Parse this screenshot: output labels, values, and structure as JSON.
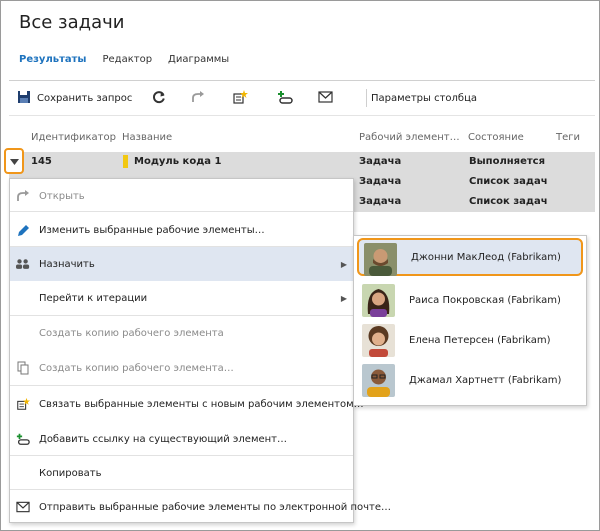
{
  "page": {
    "title": "Все задачи"
  },
  "tabs": [
    {
      "label": "Результаты",
      "active": true
    },
    {
      "label": "Редактор",
      "active": false
    },
    {
      "label": "Диаграммы",
      "active": false
    }
  ],
  "toolbar": {
    "save_label": "Сохранить запрос",
    "column_options_label": "Параметры столбца",
    "icons": [
      "save-icon",
      "refresh-icon",
      "redo-icon",
      "new-linked-item-icon",
      "add-link-icon",
      "mail-icon"
    ]
  },
  "grid": {
    "columns": [
      "Идентификатор",
      "Название",
      "Рабочий элемент…",
      "Состояние",
      "Теги"
    ],
    "rows": [
      {
        "id": "145",
        "title": "Модуль кода 1",
        "type": "Задача",
        "state": "Выполняется",
        "color": "#f2c811"
      },
      {
        "id": "",
        "title": "",
        "type": "Задача",
        "state": "Список задач"
      },
      {
        "id": "",
        "title": "",
        "type": "Задача",
        "state": "Список задач"
      }
    ]
  },
  "context_menu": {
    "items": [
      {
        "label": "Открыть",
        "icon": "redo-icon",
        "disabled": false
      },
      {
        "label": "Изменить выбранные рабочие элементы…",
        "icon": "pencil-icon",
        "disabled": false
      },
      {
        "label": "Назначить",
        "icon": "people-icon",
        "disabled": false,
        "has_submenu": true,
        "highlighted": true
      },
      {
        "label": "Перейти к итерации",
        "icon": "",
        "disabled": false,
        "has_submenu": true
      },
      {
        "label": "Создать копию рабочего элемента",
        "icon": "",
        "disabled": true
      },
      {
        "label": "Создать копию рабочего элемента…",
        "icon": "copy-icon",
        "disabled": true
      },
      {
        "label": "Связать выбранные элементы с новым рабочим элементом…",
        "icon": "new-linked-item-icon",
        "disabled": false
      },
      {
        "label": "Добавить ссылку на существующий элемент…",
        "icon": "add-link-icon",
        "disabled": false
      },
      {
        "label": "Копировать",
        "icon": "",
        "disabled": false
      },
      {
        "label": "Отправить выбранные рабочие элементы по электронной почте…",
        "icon": "mail-icon",
        "disabled": false
      }
    ]
  },
  "assign_submenu": {
    "people": [
      {
        "name": "Джонни МакЛеод (Fabrikam)",
        "avatar": "avatar-man-beard"
      },
      {
        "name": "Раиса Покровская (Fabrikam)",
        "avatar": "avatar-woman-dark-hair"
      },
      {
        "name": "Елена Петерсен (Fabrikam)",
        "avatar": "avatar-woman-curly-hair"
      },
      {
        "name": "Джамал Хартнетт (Fabrikam)",
        "avatar": "avatar-man-glasses"
      }
    ]
  },
  "colors": {
    "accent": "#1e73be",
    "highlight_border": "#f0961a",
    "menu_hover": "#dfe6f1",
    "selected_row": "#dcdcdc"
  }
}
